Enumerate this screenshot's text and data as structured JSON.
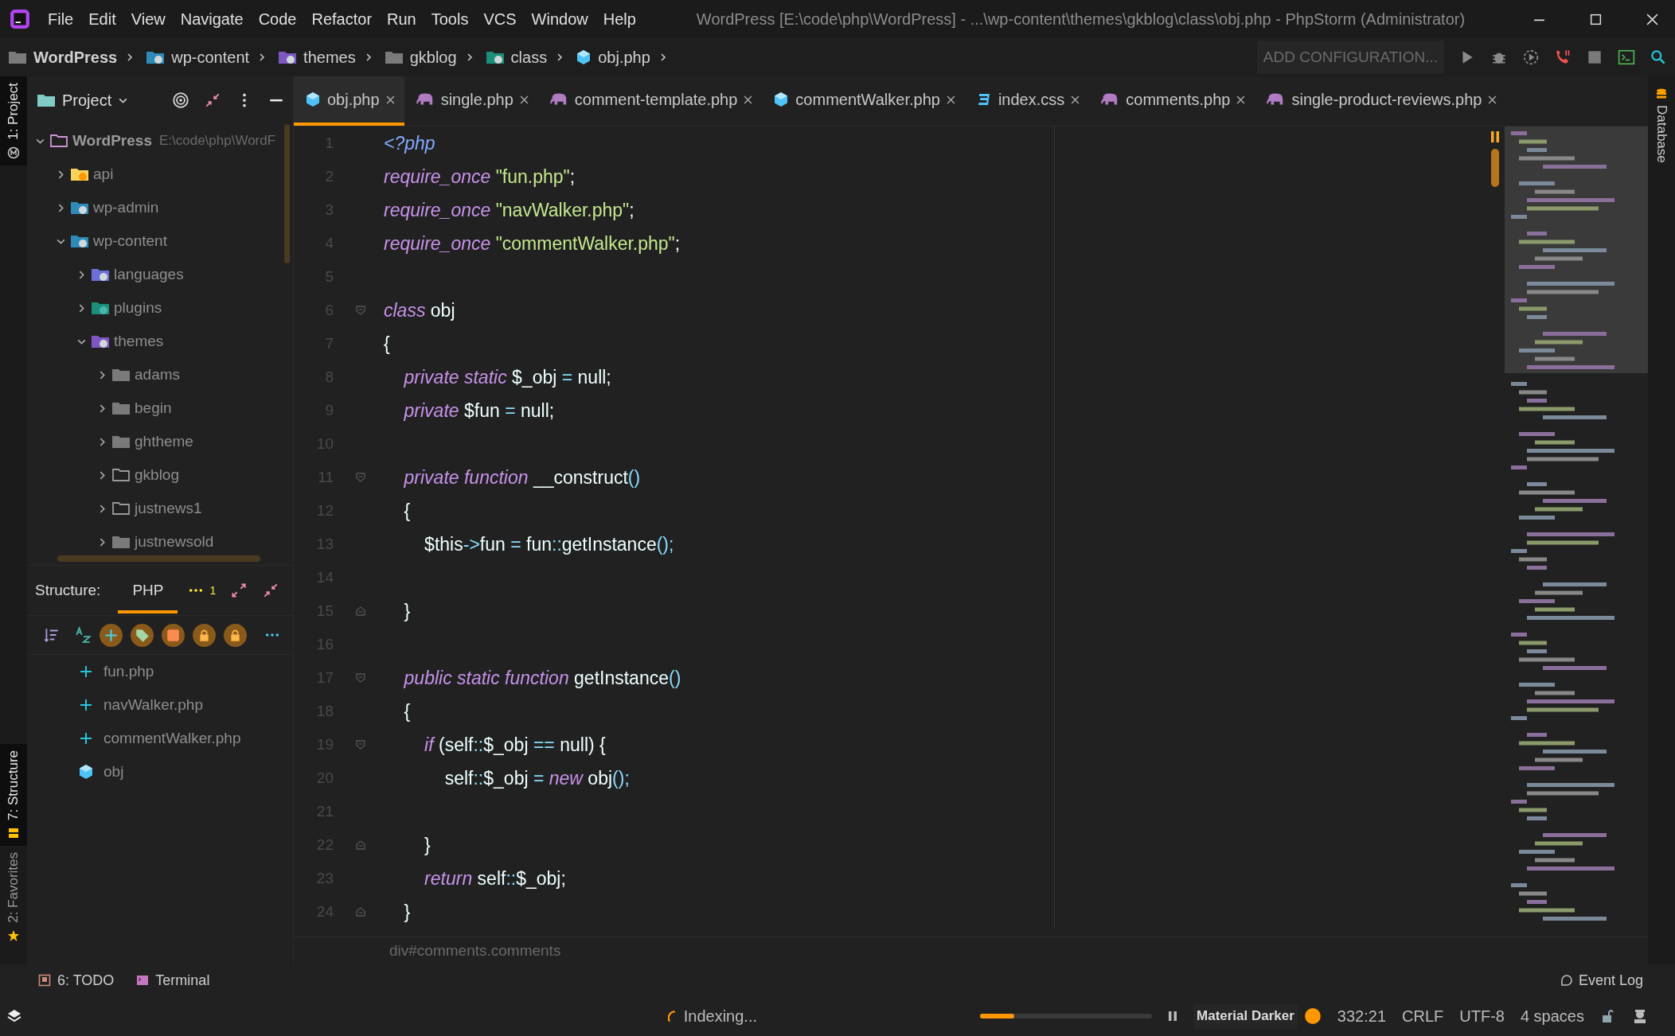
{
  "title_bar": {
    "menu": [
      "File",
      "Edit",
      "View",
      "Navigate",
      "Code",
      "Refactor",
      "Run",
      "Tools",
      "VCS",
      "Window",
      "Help"
    ],
    "title": "WordPress [E:\\code\\php\\WordPress] - ...\\wp-content\\themes\\gkblog\\class\\obj.php - PhpStorm (Administrator)"
  },
  "nav_bar": {
    "breadcrumbs": [
      {
        "label": "WordPress",
        "kind": "folder"
      },
      {
        "label": "wp-content",
        "kind": "wordpress"
      },
      {
        "label": "themes",
        "kind": "themes"
      },
      {
        "label": "gkblog",
        "kind": "folder"
      },
      {
        "label": "class",
        "kind": "classes"
      },
      {
        "label": "obj.php",
        "kind": "class"
      }
    ],
    "run_config": "ADD CONFIGURATION..."
  },
  "left_stripe": {
    "top": [
      {
        "label": "1: Project",
        "selected": true
      }
    ],
    "bottom": [
      {
        "label": "7: Structure",
        "selected": true
      },
      {
        "label": "2: Favorites",
        "selected": false
      }
    ]
  },
  "project_panel": {
    "title": "Project",
    "tree": [
      {
        "label": "WordPress",
        "path": "E:\\code\\php\\WordF",
        "kind": "project",
        "expanded": true,
        "children": [
          {
            "label": "api",
            "kind": "api",
            "expanded": false
          },
          {
            "label": "wp-admin",
            "kind": "wordpress",
            "expanded": false
          },
          {
            "label": "wp-content",
            "kind": "wordpress",
            "expanded": true,
            "children": [
              {
                "label": "languages",
                "kind": "languages",
                "expanded": false
              },
              {
                "label": "plugins",
                "kind": "plugins",
                "expanded": false
              },
              {
                "label": "themes",
                "kind": "themes",
                "expanded": true,
                "children": [
                  {
                    "label": "adams",
                    "kind": "folder",
                    "expanded": false
                  },
                  {
                    "label": "begin",
                    "kind": "folder",
                    "expanded": false
                  },
                  {
                    "label": "ghtheme",
                    "kind": "folder",
                    "expanded": false
                  },
                  {
                    "label": "gkblog",
                    "kind": "outline",
                    "expanded": false
                  },
                  {
                    "label": "justnews1",
                    "kind": "outline",
                    "expanded": false
                  },
                  {
                    "label": "justnewsold",
                    "kind": "folder",
                    "expanded": false
                  }
                ]
              }
            ]
          }
        ]
      }
    ]
  },
  "structure_panel": {
    "label": "Structure:",
    "tabs": [
      {
        "label": "PHP",
        "selected": true
      }
    ],
    "badge": "1",
    "items": [
      {
        "label": "fun.php",
        "kind": "include"
      },
      {
        "label": "navWalker.php",
        "kind": "include"
      },
      {
        "label": "commentWalker.php",
        "kind": "include"
      },
      {
        "label": "obj",
        "kind": "class"
      }
    ]
  },
  "editor": {
    "tabs": [
      {
        "label": "obj.php",
        "kind": "class",
        "selected": true
      },
      {
        "label": "single.php",
        "kind": "php",
        "selected": false
      },
      {
        "label": "comment-template.php",
        "kind": "php",
        "selected": false
      },
      {
        "label": "commentWalker.php",
        "kind": "class",
        "selected": false
      },
      {
        "label": "index.css",
        "kind": "css",
        "selected": false
      },
      {
        "label": "comments.php",
        "kind": "php",
        "selected": false
      },
      {
        "label": "single-product-reviews.php",
        "kind": "php",
        "selected": false
      }
    ],
    "lines": [
      {
        "number": "1",
        "segments": [
          {
            "kind": "tag",
            "text": "<?php"
          }
        ]
      },
      {
        "number": "2",
        "segments": [
          {
            "kind": "keyword",
            "text": "require_once"
          },
          {
            "kind": "string",
            "text": " \"fun.php\""
          },
          {
            "kind": "plain",
            "text": ";"
          }
        ]
      },
      {
        "number": "3",
        "segments": [
          {
            "kind": "keyword",
            "text": "require_once"
          },
          {
            "kind": "string",
            "text": " \"navWalker.php\""
          },
          {
            "kind": "plain",
            "text": ";"
          }
        ]
      },
      {
        "number": "4",
        "segments": [
          {
            "kind": "keyword",
            "text": "require_once"
          },
          {
            "kind": "string",
            "text": " \"commentWalker.php\""
          },
          {
            "kind": "plain",
            "text": ";"
          }
        ]
      },
      {
        "number": "5"
      },
      {
        "number": "6",
        "segments": [
          {
            "kind": "keyword",
            "text": "class"
          },
          {
            "kind": "plain",
            "text": " obj"
          }
        ],
        "kind": "fold-start"
      },
      {
        "number": "7",
        "segments": [
          {
            "kind": "plain",
            "text": "{"
          }
        ]
      },
      {
        "number": "8",
        "segments": [
          {
            "kind": "keyword",
            "text": "    private static"
          },
          {
            "kind": "plain",
            "text": " $_obj "
          },
          {
            "kind": "op",
            "text": "="
          },
          {
            "kind": "plain",
            "text": " null;"
          }
        ]
      },
      {
        "number": "9",
        "segments": [
          {
            "kind": "keyword",
            "text": "    private"
          },
          {
            "kind": "plain",
            "text": " $fun "
          },
          {
            "kind": "op",
            "text": "="
          },
          {
            "kind": "plain",
            "text": " null;"
          }
        ]
      },
      {
        "number": "10"
      },
      {
        "number": "11",
        "segments": [
          {
            "kind": "keyword",
            "text": "    private function"
          },
          {
            "kind": "plain",
            "text": " __construct"
          },
          {
            "kind": "op",
            "text": "()"
          }
        ],
        "kind": "fold-start"
      },
      {
        "number": "12",
        "segments": [
          {
            "kind": "plain",
            "text": "    {"
          }
        ]
      },
      {
        "number": "13",
        "segments": [
          {
            "kind": "plain",
            "text": "        $this"
          },
          {
            "kind": "op",
            "text": "->"
          },
          {
            "kind": "plain",
            "text": "fun "
          },
          {
            "kind": "op",
            "text": "="
          },
          {
            "kind": "plain",
            "text": " fun"
          },
          {
            "kind": "op",
            "text": "::"
          },
          {
            "kind": "plain",
            "text": "getInstance"
          },
          {
            "kind": "op",
            "text": "();"
          }
        ]
      },
      {
        "number": "14"
      },
      {
        "number": "15",
        "segments": [
          {
            "kind": "plain",
            "text": "    }"
          }
        ],
        "kind": "fold-end"
      },
      {
        "number": "16"
      },
      {
        "number": "17",
        "segments": [
          {
            "kind": "keyword",
            "text": "    public static function"
          },
          {
            "kind": "plain",
            "text": " getInstance"
          },
          {
            "kind": "op",
            "text": "()"
          }
        ],
        "kind": "fold-start"
      },
      {
        "number": "18",
        "segments": [
          {
            "kind": "plain",
            "text": "    {"
          }
        ]
      },
      {
        "number": "19",
        "segments": [
          {
            "kind": "keyword",
            "text": "        if"
          },
          {
            "kind": "plain",
            "text": " (self"
          },
          {
            "kind": "op",
            "text": "::"
          },
          {
            "kind": "plain",
            "text": "$_obj "
          },
          {
            "kind": "op",
            "text": "=="
          },
          {
            "kind": "plain",
            "text": " null) {"
          }
        ],
        "kind": "fold-start"
      },
      {
        "number": "20",
        "segments": [
          {
            "kind": "plain",
            "text": "            self"
          },
          {
            "kind": "op",
            "text": "::"
          },
          {
            "kind": "plain",
            "text": "$_obj "
          },
          {
            "kind": "op",
            "text": "="
          },
          {
            "kind": "keyword",
            "text": " new"
          },
          {
            "kind": "plain",
            "text": " obj"
          },
          {
            "kind": "op",
            "text": "();"
          }
        ]
      },
      {
        "number": "21"
      },
      {
        "number": "22",
        "segments": [
          {
            "kind": "plain",
            "text": "        }"
          }
        ],
        "kind": "fold-end"
      },
      {
        "number": "23",
        "segments": [
          {
            "kind": "keyword",
            "text": "        return"
          },
          {
            "kind": "plain",
            "text": " self"
          },
          {
            "kind": "op",
            "text": "::"
          },
          {
            "kind": "plain",
            "text": "$_obj;"
          }
        ]
      },
      {
        "number": "24",
        "segments": [
          {
            "kind": "plain",
            "text": "    }"
          }
        ],
        "kind": "fold-end"
      }
    ],
    "breadcrumb": "div#comments.comments"
  },
  "right_stripe": [
    {
      "label": "Database"
    }
  ],
  "bottom_tools": {
    "left": [
      {
        "label": "6: TODO",
        "kind": "todo"
      },
      {
        "label": "Terminal",
        "kind": "terminal"
      }
    ],
    "right": [
      {
        "label": "Event Log",
        "kind": "log"
      }
    ]
  },
  "status_bar": {
    "task": "Indexing...",
    "level": 0.2,
    "theme": "Material Darker",
    "position": "332:21",
    "line_separator": "CRLF",
    "encoding": "UTF-8",
    "indent": "4 spaces"
  }
}
